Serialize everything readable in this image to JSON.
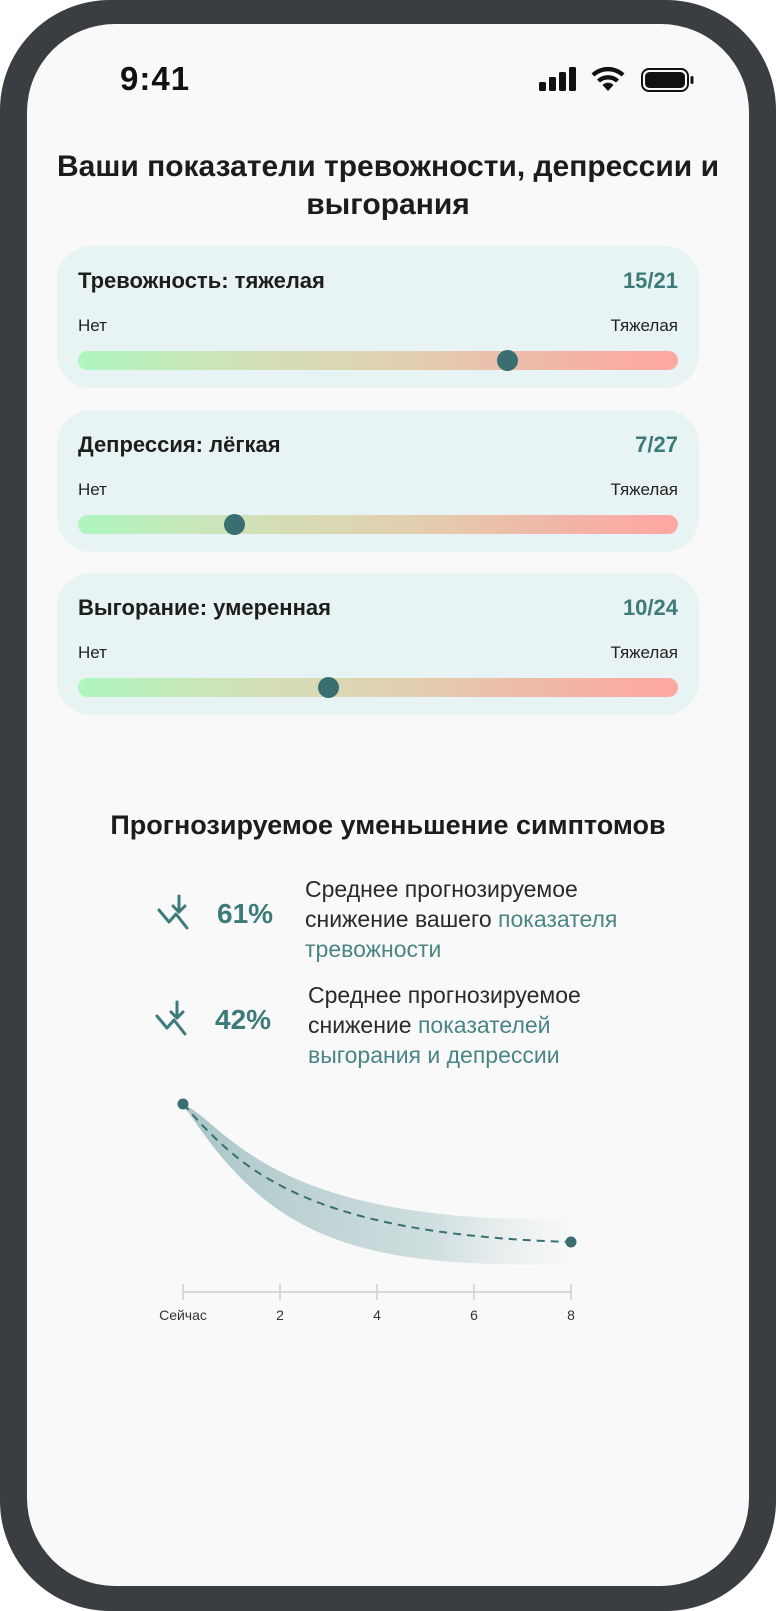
{
  "status_bar": {
    "time": "9:41"
  },
  "title": "Ваши показатели тревожности, депрессии и выгорания",
  "scales": [
    {
      "label": "Тревожность: тяжелая",
      "score": "15/21",
      "min_label": "Нет",
      "max_label": "Тяжелая",
      "value": 15,
      "max": 21
    },
    {
      "label": "Депрессия: лёгкая",
      "score": "7/27",
      "min_label": "Нет",
      "max_label": "Тяжелая",
      "value": 7,
      "max": 27
    },
    {
      "label": "Выгорание: умеренная",
      "score": "10/24",
      "min_label": "Нет",
      "max_label": "Тяжелая",
      "value": 10,
      "max": 24
    }
  ],
  "forecast": {
    "title": "Прогнозируемое уменьшение симптомов",
    "items": [
      {
        "percent": "61%",
        "text_plain": "Среднее прогнозируемое снижение вашего ",
        "text_highlight": "показателя тревожности",
        "icon": "trending-down-icon"
      },
      {
        "percent": "42%",
        "text_plain": "Среднее прогнозируемое снижение ",
        "text_highlight": "показателей выгорания и депрессии",
        "icon": "trending-down-icon"
      }
    ],
    "axis_ticks": [
      "Сейчас",
      "2",
      "4",
      "6",
      "8"
    ]
  },
  "colors": {
    "accent": "#3d7a7a",
    "knob": "#3a6f72",
    "card_bg": "#e8f3f3",
    "bar_start": "#aef6c0",
    "bar_end": "#ffa7a2"
  }
}
